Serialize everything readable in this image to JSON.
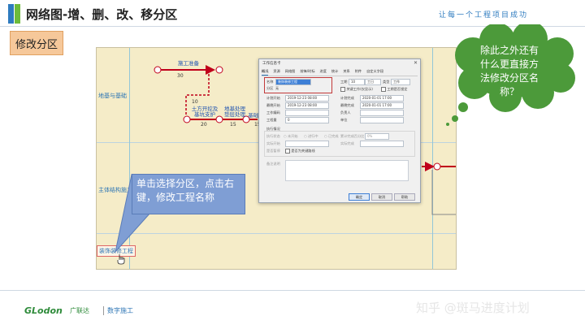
{
  "header": {
    "title": "网络图-增、删、改、移分区",
    "slogan": "让每一个工程项目成功"
  },
  "section_tag": "修改分区",
  "lanes": [
    {
      "label": "地基与基础"
    },
    {
      "label": "主体结构施工"
    },
    {
      "label": "装饰装修工程"
    }
  ],
  "activities": [
    {
      "label": "施工准备",
      "duration": "30"
    },
    {
      "label": "10"
    },
    {
      "label": "土方开挖及\n基坑支护",
      "duration": "20"
    },
    {
      "label": "地基处理\n垫层处理",
      "duration": "15"
    },
    {
      "label": "基础梁",
      "duration": "15"
    }
  ],
  "dialog": {
    "title": "工作信息卡",
    "tabs": [
      "概况",
      "资源",
      "网络图",
      "前锋/时标",
      "进度",
      "统计",
      "关系",
      "附件",
      "自定义字段"
    ],
    "name_label": "名称",
    "name_value": "装饰装修工程",
    "partition_label": "分区",
    "partition_value": "无",
    "work_label": "工期",
    "work_value": "10",
    "work_unit": "工日",
    "type_label": "类型",
    "type_value": "工作",
    "key_chk": "关键工作(仅显示)",
    "milestone_chk": "工期是否锁定",
    "plan_start_label": "计划开始",
    "plan_start": "2019-12-23 08:00",
    "plan_end_label": "计划完成",
    "plan_end": "2020-01-01 17:00",
    "late_start_label": "最晚开始",
    "late_start": "2019-12-23 08:00",
    "late_end_label": "最晚完成",
    "late_end": "2020-01-01 17:00",
    "code_label": "工作编码",
    "owner_label": "负责人",
    "qty_label": "工程量",
    "qty_value": "0",
    "unit_label": "单位",
    "progress_section": "执行情况",
    "progress_label": "执行状态",
    "opt_not_started": "未开始",
    "opt_in_progress": "进行中",
    "opt_done": "已完成",
    "percent_label": "累计完成百分比",
    "percent_value": "0%",
    "date_label": "实际开始",
    "date_label2": "实际完成",
    "resume_label": "是否暂停",
    "resume_chk": "是否为关键路线",
    "remark_label": "备注说明",
    "ok": "确定",
    "cancel": "取消",
    "help": "帮助"
  },
  "callout_box": "单击选择分区，点击右键，修改工程名称",
  "callout_cloud": "除此之外还有什么更直接方法修改分区名称？",
  "footer": {
    "logo": "GLodon",
    "logo_cn": "广联达",
    "logo_sub": "数字施工",
    "watermark": "知乎 @斑马进度计划"
  },
  "colors": {
    "accent_blue": "#2e7bbf",
    "accent_green": "#6dbb3a",
    "critical_red": "#c0001a",
    "callout_blue": "#7f9ed4",
    "cloud_green": "#4c9a3a"
  }
}
